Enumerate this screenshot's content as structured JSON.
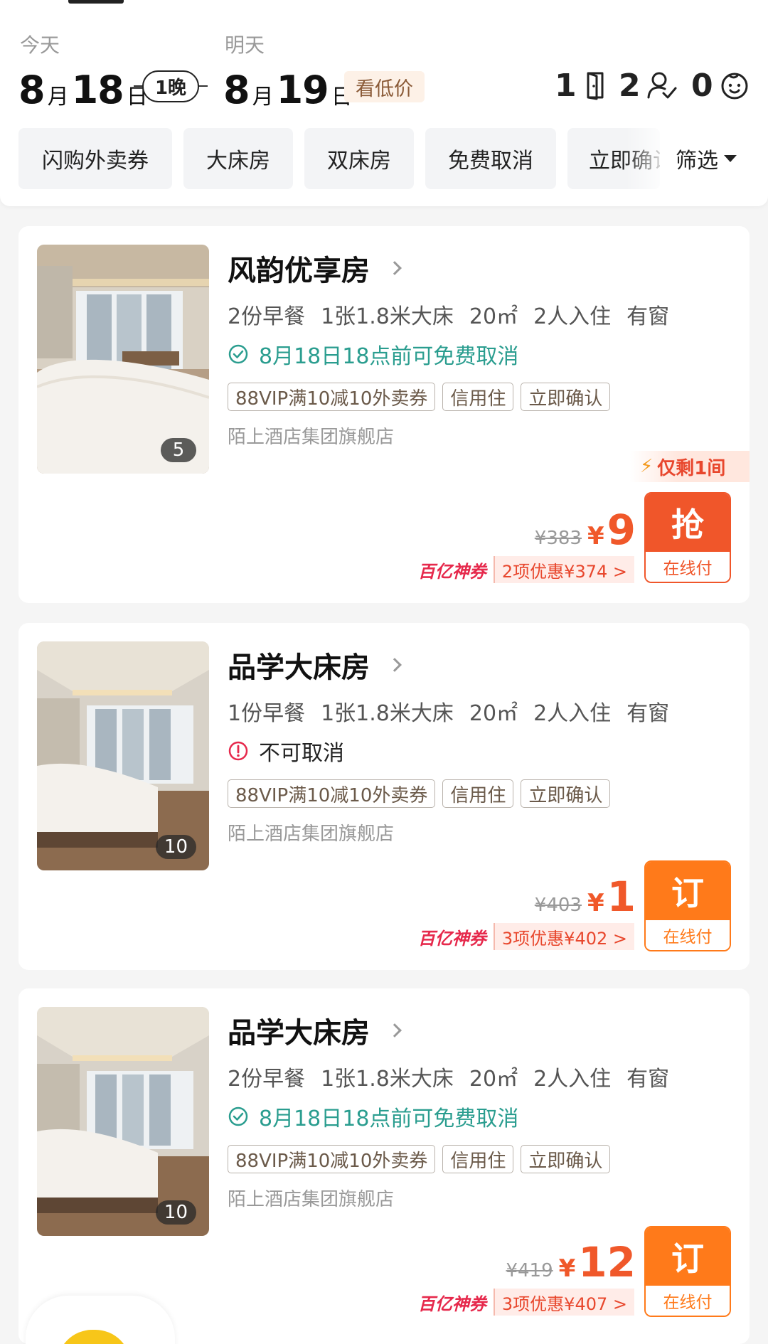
{
  "header": {
    "checkin": {
      "label": "今天",
      "month": "8",
      "month_unit": "月",
      "day": "18",
      "day_unit": "日"
    },
    "nights": "1晚",
    "checkout": {
      "label": "明天",
      "month": "8",
      "month_unit": "月",
      "day": "19",
      "day_unit": "日"
    },
    "low_price_label": "看低价",
    "rooms": "1",
    "adults": "2",
    "children": "0"
  },
  "filters": {
    "chips": [
      "闪购外卖券",
      "大床房",
      "双床房",
      "免费取消",
      "立即确认"
    ],
    "filter_label": "筛选"
  },
  "rooms": [
    {
      "title": "风韵优享房",
      "specs": [
        "2份早餐",
        "1张1.8米大床",
        "20㎡",
        "2人入住",
        "有窗"
      ],
      "policy": "8月18日18点前可免费取消",
      "policy_type": "free-cancel",
      "tags": [
        "88VIP满10减10外卖券",
        "信用住",
        "立即确认"
      ],
      "shop": "陌上酒店集团旗舰店",
      "photo_count": "5",
      "scarcity": "仅剩1间",
      "old_price": "¥383",
      "currency": "¥",
      "price": "9",
      "promo_brand": "百亿神券",
      "promo_detail": "2项优惠¥374 >",
      "book_label": "抢",
      "pay_label": "在线付"
    },
    {
      "title": "品学大床房",
      "specs": [
        "1份早餐",
        "1张1.8米大床",
        "20㎡",
        "2人入住",
        "有窗"
      ],
      "policy": "不可取消",
      "policy_type": "no-cancel",
      "tags": [
        "88VIP满10减10外卖券",
        "信用住",
        "立即确认"
      ],
      "shop": "陌上酒店集团旗舰店",
      "photo_count": "10",
      "old_price": "¥403",
      "currency": "¥",
      "price": "1",
      "promo_brand": "百亿神券",
      "promo_detail": "3项优惠¥402 >",
      "book_label": "订",
      "pay_label": "在线付"
    },
    {
      "title": "品学大床房",
      "specs": [
        "2份早餐",
        "1张1.8米大床",
        "20㎡",
        "2人入住",
        "有窗"
      ],
      "policy": "8月18日18点前可免费取消",
      "policy_type": "free-cancel",
      "tags": [
        "88VIP满10减10外卖券",
        "信用住",
        "立即确认"
      ],
      "shop": "陌上酒店集团旗舰店",
      "photo_count": "10",
      "old_price": "¥419",
      "currency": "¥",
      "price": "12",
      "promo_brand": "百亿神券",
      "promo_detail": "3项优惠¥407 >",
      "book_label": "订",
      "pay_label": "在线付"
    }
  ],
  "colors": {
    "accent": "#f0582a",
    "book_red": "#f0562a",
    "book_orange": "#ff7a1a",
    "free_cancel": "#2a9d8f",
    "promo_brand": "#e6294c"
  }
}
